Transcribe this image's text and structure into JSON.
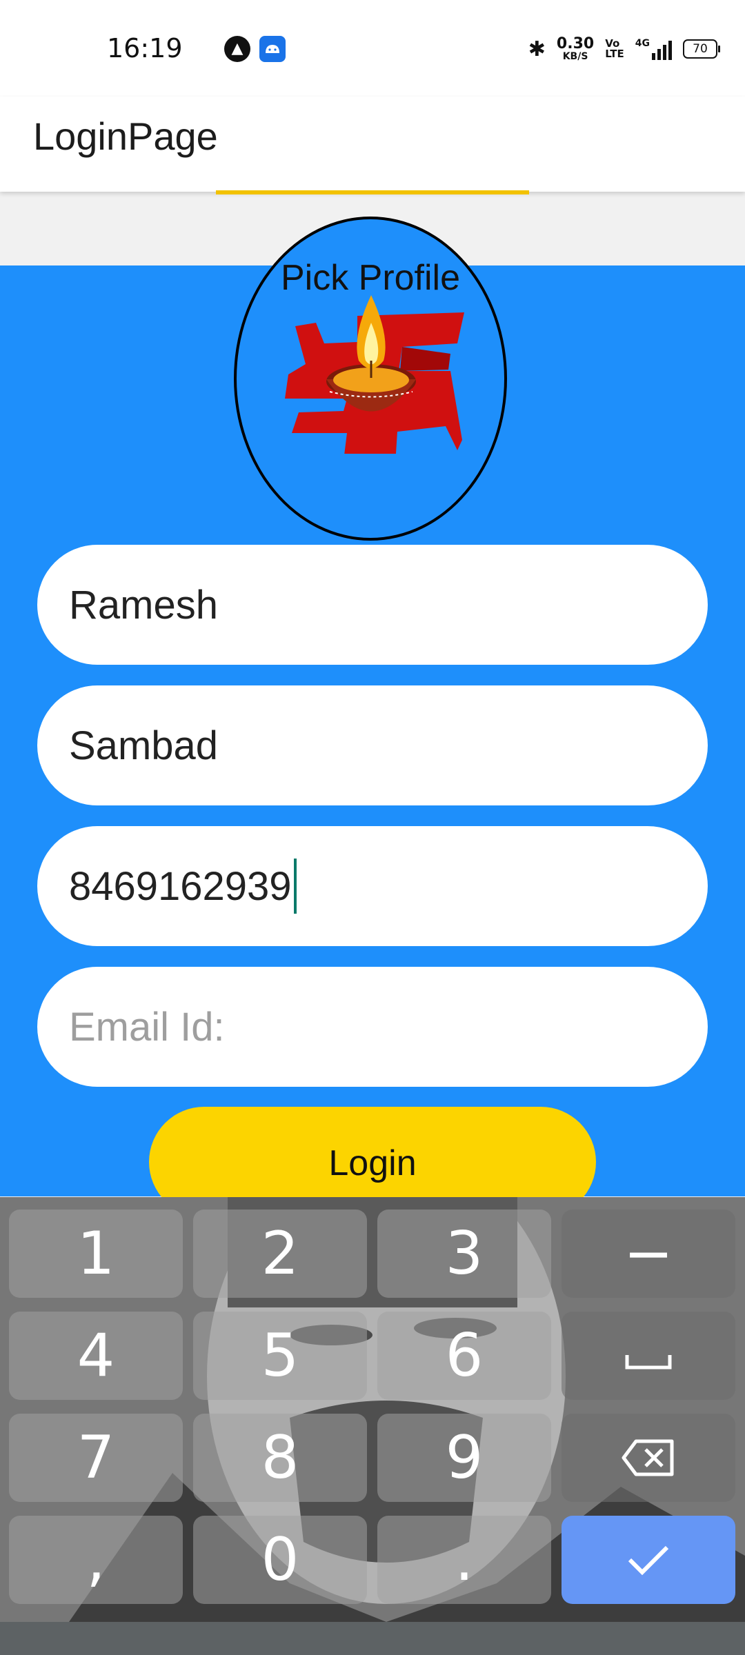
{
  "status_bar": {
    "time": "16:19",
    "notification_icons": [
      "a-icon",
      "android-icon"
    ],
    "network_speed_value": "0.30",
    "network_speed_unit": "KB/S",
    "volte_top": "Vo",
    "volte_bottom": "LTE",
    "network_type": "4G",
    "battery": "70"
  },
  "app_bar": {
    "title": "LoginPage",
    "accent_color": "#f2c200"
  },
  "profile": {
    "label": "Pick Profile"
  },
  "form": {
    "first_name": "Ramesh",
    "last_name": "Sambad",
    "phone": "8469162939",
    "email_placeholder": "Email Id:",
    "login_label": "Login"
  },
  "colors": {
    "background": "#1e8ffb",
    "button": "#fcd400",
    "done_key": "#6596f5"
  },
  "keyboard": {
    "rows": [
      [
        "1",
        "2",
        "3",
        "−"
      ],
      [
        "4",
        "5",
        "6",
        "space-icon"
      ],
      [
        "7",
        "8",
        "9",
        "backspace-icon"
      ],
      [
        ",",
        "0",
        ".",
        "check-icon"
      ]
    ]
  }
}
